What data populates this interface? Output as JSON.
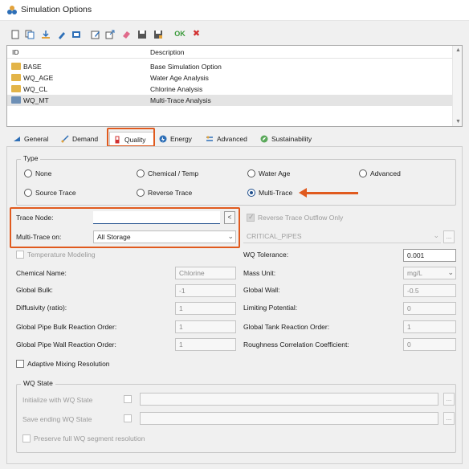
{
  "window": {
    "title": "Simulation Options"
  },
  "toolbar": {
    "icons": [
      "new-icon",
      "duplicate-icon",
      "import-icon",
      "rename-icon",
      "copy-icon",
      "edit-icon",
      "export-icon",
      "delete-icon",
      "save-icon",
      "save-as-icon"
    ],
    "ok_label": "OK",
    "cancel_label": "✖"
  },
  "list": {
    "columns": {
      "id": "ID",
      "description": "Description"
    },
    "rows": [
      {
        "id": "BASE",
        "description": "Base Simulation Option"
      },
      {
        "id": "WQ_AGE",
        "description": "Water Age Analysis"
      },
      {
        "id": "WQ_CL",
        "description": "Chlorine Analysis"
      },
      {
        "id": "WQ_MT",
        "description": "Multi-Trace Analysis"
      }
    ]
  },
  "tabs": [
    {
      "label": "General",
      "icon": "general-icon"
    },
    {
      "label": "Demand",
      "icon": "demand-icon"
    },
    {
      "label": "Quality",
      "icon": "quality-icon"
    },
    {
      "label": "Energy",
      "icon": "energy-icon"
    },
    {
      "label": "Advanced",
      "icon": "advanced-icon"
    },
    {
      "label": "Sustainability",
      "icon": "sustainability-icon"
    }
  ],
  "type_group": {
    "label": "Type",
    "options": [
      "None",
      "Chemical / Temp",
      "Water Age",
      "Advanced",
      "Source Trace",
      "Reverse Trace",
      "Multi-Trace"
    ],
    "selected": "Multi-Trace"
  },
  "trace": {
    "trace_node_label": "Trace Node:",
    "trace_node_value": "",
    "trace_node_button": "<",
    "multi_trace_on_label": "Multi-Trace on:",
    "multi_trace_on_value": "All Storage",
    "reverse_outflow_label": "Reverse Trace Outflow Only",
    "critical_pipes_value": "CRITICAL_PIPES",
    "ellipsis": "..."
  },
  "params": {
    "temperature_modeling": "Temperature Modeling",
    "wq_tolerance_label": "WQ Tolerance:",
    "wq_tolerance_value": "0.001",
    "chemical_name_label": "Chemical Name:",
    "chemical_name_value": "Chlorine",
    "mass_unit_label": "Mass Unit:",
    "mass_unit_value": "mg/L",
    "global_bulk_label": "Global Bulk:",
    "global_bulk_value": "-1",
    "global_wall_label": "Global Wall:",
    "global_wall_value": "-0.5",
    "diffusivity_label": "Diffusivity (ratio):",
    "diffusivity_value": "1",
    "limiting_potential_label": "Limiting Potential:",
    "limiting_potential_value": "0",
    "bulk_order_label": "Global Pipe Bulk Reaction Order:",
    "bulk_order_value": "1",
    "tank_order_label": "Global Tank Reaction Order:",
    "tank_order_value": "1",
    "wall_order_label": "Global Pipe Wall Reaction Order:",
    "wall_order_value": "1",
    "roughness_label": "Roughness Correlation Coefficient:",
    "roughness_value": "0",
    "adaptive_mixing_label": "Adaptive Mixing Resolution"
  },
  "wq_state": {
    "label": "WQ State",
    "initialize_label": "Initialize with WQ State",
    "save_ending_label": "Save ending WQ State",
    "preserve_label": "Preserve full WQ segment resolution",
    "ellipsis": "..."
  },
  "colors": {
    "highlight": "#e05a1e",
    "accent": "#1f4e8c"
  }
}
